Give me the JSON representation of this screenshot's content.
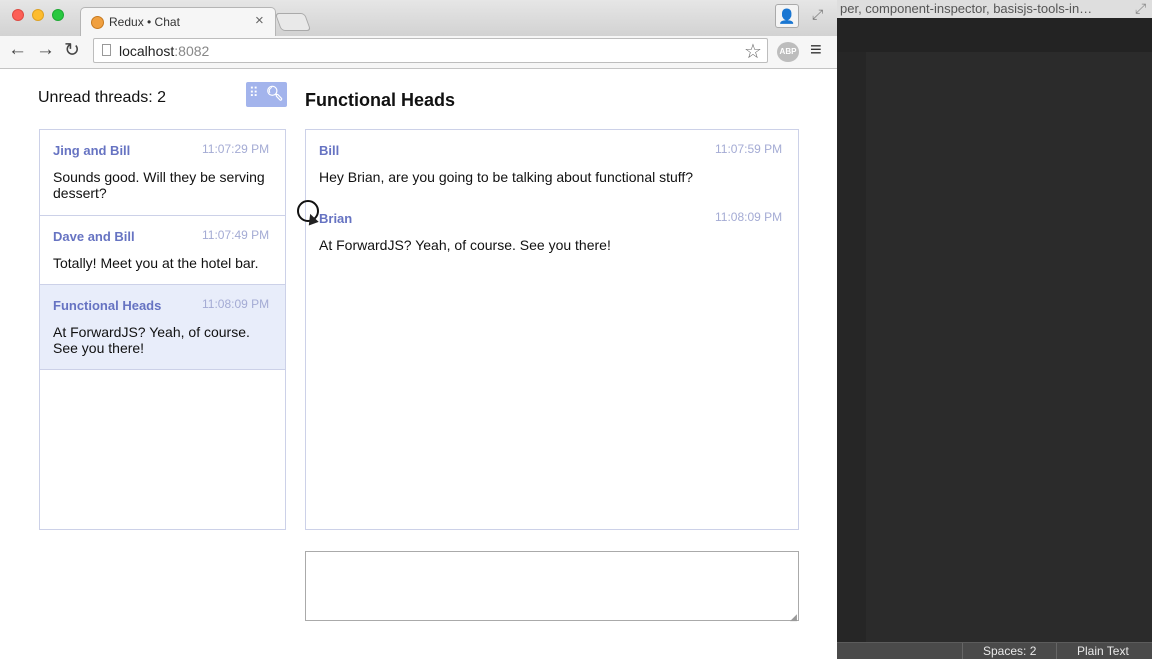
{
  "browser": {
    "tab_title": "Redux • Chat",
    "tab_close": "×",
    "url_host": "localhost",
    "url_port": ":8082",
    "icons": {
      "back": "←",
      "forward": "→",
      "reload": "↻",
      "star": "☆",
      "adblock": "ABP",
      "menu": "≡",
      "profile": "👤",
      "fullscreen": "⤢"
    },
    "traffic_lights": [
      "#fc5f57",
      "#fdbc2e",
      "#28c840"
    ]
  },
  "chat": {
    "unread_label": "Unread threads: 2",
    "devtools_icons": {
      "dots": "⠿",
      "search": "🔍︎"
    },
    "threads": [
      {
        "name": "Jing and Bill",
        "time": "11:07:29 PM",
        "text": "Sounds good. Will they be serving dessert?",
        "active": false
      },
      {
        "name": "Dave and Bill",
        "time": "11:07:49 PM",
        "text": "Totally! Meet you at the hotel bar.",
        "active": false
      },
      {
        "name": "Functional Heads",
        "time": "11:08:09 PM",
        "text": "At ForwardJS? Yeah, of course. See you there!",
        "active": true
      }
    ],
    "current_thread_title": "Functional Heads",
    "messages": [
      {
        "author": "Bill",
        "time": "11:07:59 PM",
        "text": "Hey Brian, are you going to be talking about functional stuff?"
      },
      {
        "author": "Brian",
        "time": "11:08:09 PM",
        "text": "At ForwardJS? Yeah, of course. See you there!"
      }
    ],
    "composer_value": ""
  },
  "editor": {
    "window_title": "per, component-inspector, basisjs-tools-in…",
    "expand_icon": "⤢",
    "status_spaces": "Spaces: 2",
    "status_syntax": "Plain Text"
  },
  "colors": {
    "accent_name": "#6673c2",
    "timestamp": "#a4abd4",
    "active_thread_bg": "#e8edfa",
    "border": "#ccd1e8"
  }
}
